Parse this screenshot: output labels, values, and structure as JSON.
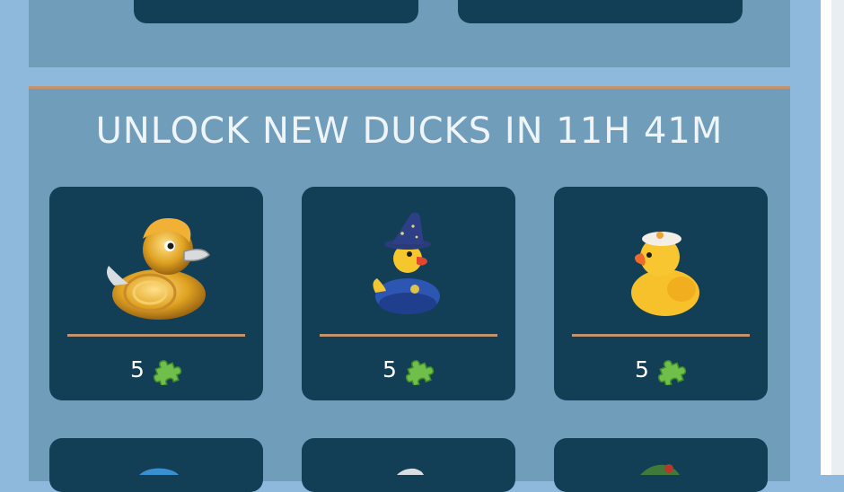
{
  "unlock": {
    "title": "UNLOCK NEW DUCKS IN 11H 41M"
  },
  "ducks": [
    {
      "name": "golden-duck",
      "price": "5",
      "currency_icon": "puzzle-piece-icon"
    },
    {
      "name": "wizard-duck",
      "price": "5",
      "currency_icon": "puzzle-piece-icon"
    },
    {
      "name": "chef-duck",
      "price": "5",
      "currency_icon": "puzzle-piece-icon"
    }
  ],
  "colors": {
    "background": "#8fb9dc",
    "panel": "#6f9dba",
    "card": "#123f55",
    "accent_line": "#c4926b",
    "puzzle": "#6fbf4a"
  }
}
